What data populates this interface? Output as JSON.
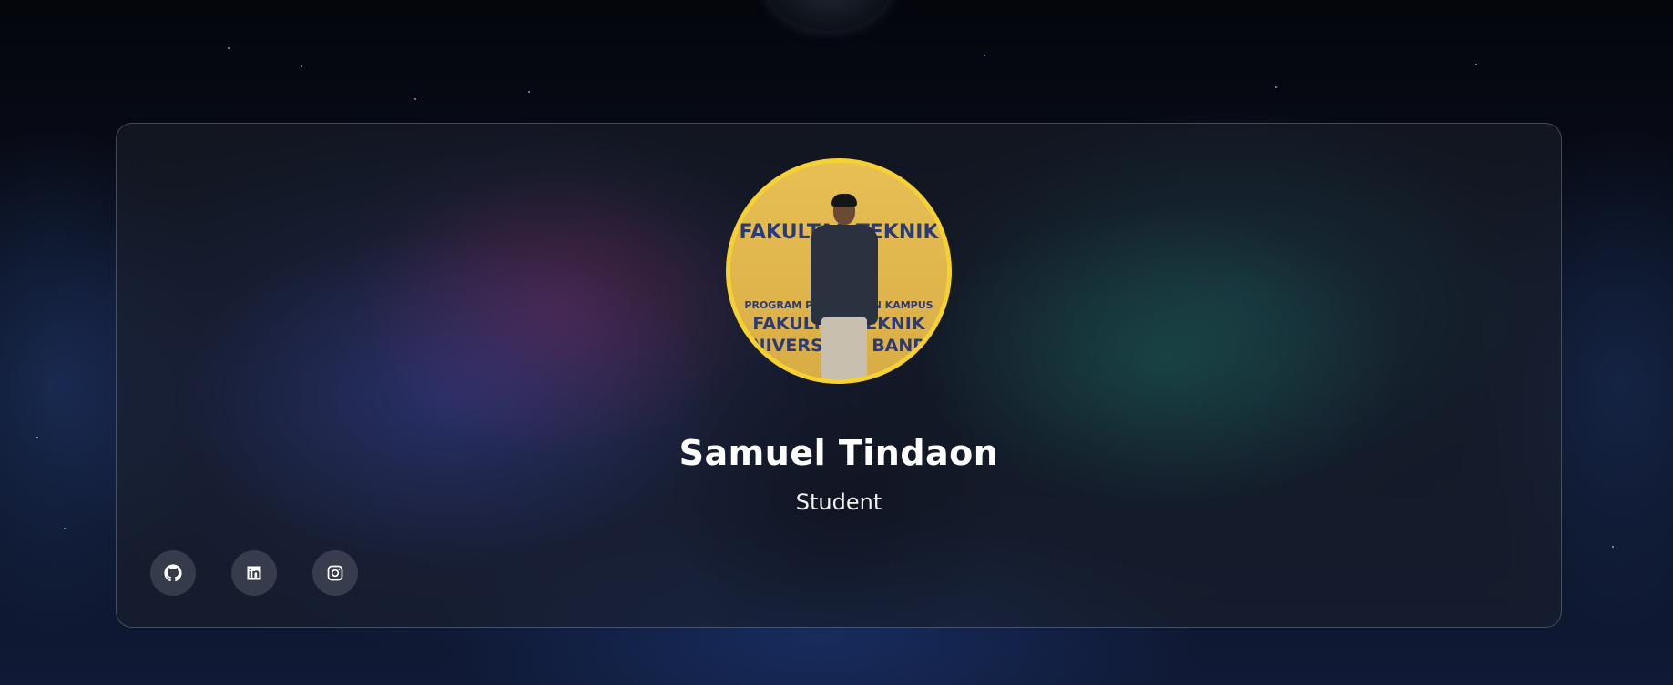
{
  "profile": {
    "name": "Samuel Tindaon",
    "role": "Student",
    "avatar_banner": {
      "line1": "FAKULTAS TEKNIK",
      "line2": "PROGRAM PENGENALAN KAMPUS",
      "line3": "FAKULTAS TEKNIK",
      "line4": "UNIVERSITAS BANDA"
    },
    "avatar_border_color": "#f5d131"
  },
  "socials": [
    {
      "name": "github",
      "icon": "github-icon"
    },
    {
      "name": "linkedin",
      "icon": "linkedin-icon"
    },
    {
      "name": "instagram",
      "icon": "instagram-icon"
    }
  ],
  "colors": {
    "card_background": "rgba(28,32,44,0.55)",
    "text": "#ffffff"
  }
}
